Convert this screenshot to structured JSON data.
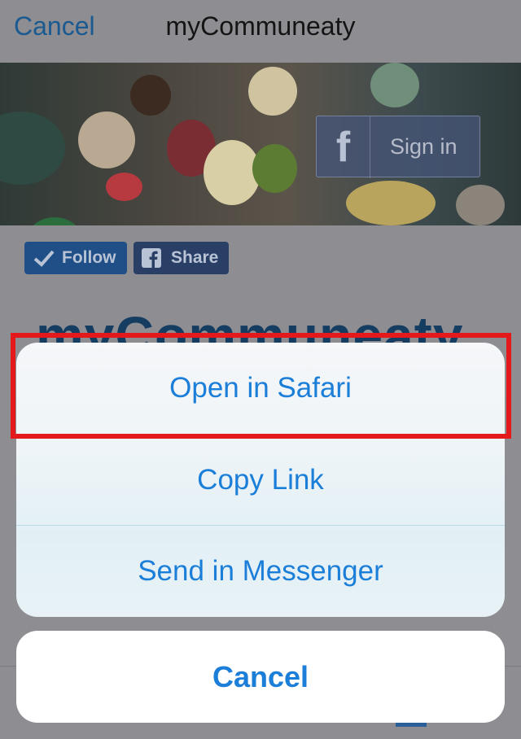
{
  "navbar": {
    "cancel_label": "Cancel",
    "title": "myCommuneaty"
  },
  "hero": {
    "signin_fb_glyph": "f",
    "signin_label": "Sign in"
  },
  "social": {
    "follow_label": "Follow",
    "share_label": "Share"
  },
  "page": {
    "big_title": "myCommuneaty"
  },
  "action_sheet": {
    "items": [
      {
        "label": "Open in Safari"
      },
      {
        "label": "Copy Link"
      },
      {
        "label": "Send in Messenger"
      }
    ],
    "cancel_label": "Cancel"
  },
  "colors": {
    "accent": "#1b7ed8",
    "highlight": "#e3191c"
  }
}
